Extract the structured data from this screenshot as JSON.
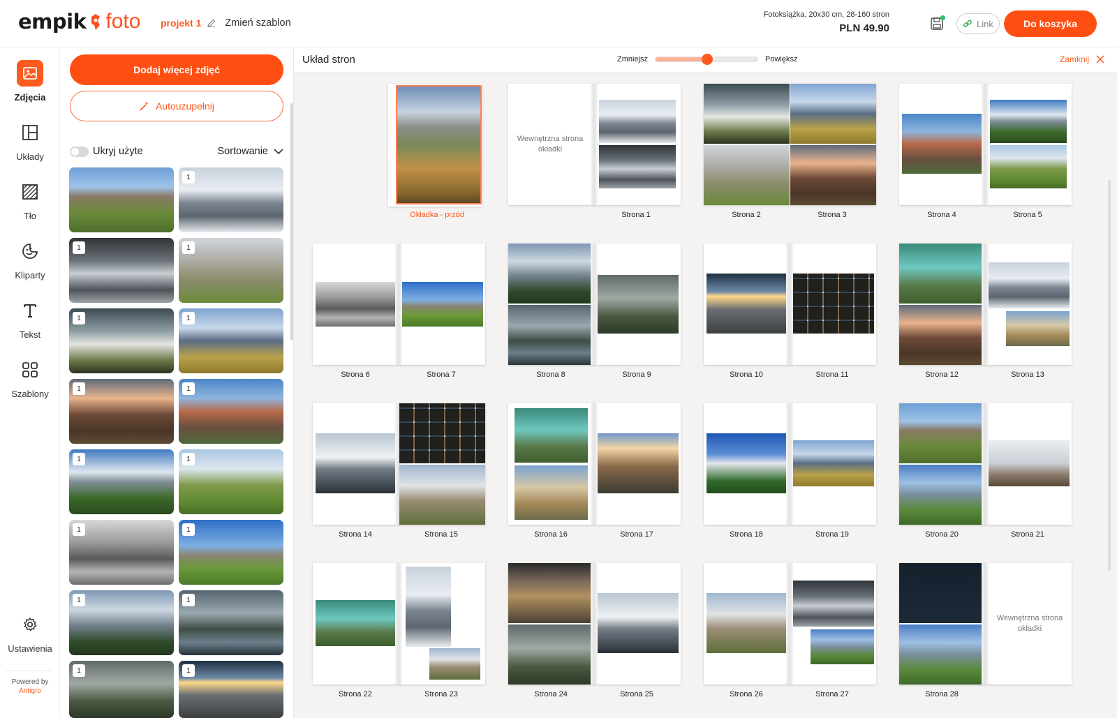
{
  "header": {
    "logo_word": "empik",
    "logo_foto": "foto",
    "project_name": "projekt 1",
    "change_template": "Zmień szablon",
    "product_desc": "Fotoksiążka, 20x30 cm, 28-160 stron",
    "price": "PLN 49.90",
    "link_label": "Link",
    "cart_label": "Do koszyka",
    "accent": "#ff4e12"
  },
  "nav": {
    "items": [
      {
        "label": "Zdjęcia",
        "icon": "image-icon"
      },
      {
        "label": "Układy",
        "icon": "layout-icon"
      },
      {
        "label": "Tło",
        "icon": "background-icon"
      },
      {
        "label": "Kliparty",
        "icon": "clipart-icon"
      },
      {
        "label": "Tekst",
        "icon": "text-icon"
      },
      {
        "label": "Szablony",
        "icon": "templates-icon"
      }
    ],
    "settings_label": "Ustawienia",
    "powered_by": "Powered by",
    "powered_brand": "Antigro"
  },
  "panel": {
    "add_photos": "Dodaj więcej zdjęć",
    "autofill": "Autouzupełnij",
    "hide_used": "Ukryj użyte",
    "hide_used_on": false,
    "sort_label": "Sortowanie",
    "photos": [
      {
        "badge": ""
      },
      {
        "badge": "1"
      },
      {
        "badge": "1"
      },
      {
        "badge": "1"
      },
      {
        "badge": "1"
      },
      {
        "badge": "1"
      },
      {
        "badge": "1"
      },
      {
        "badge": "1"
      },
      {
        "badge": "1"
      },
      {
        "badge": "1"
      },
      {
        "badge": "1"
      },
      {
        "badge": "1"
      },
      {
        "badge": "1"
      },
      {
        "badge": "1"
      },
      {
        "badge": "1"
      },
      {
        "badge": "1"
      }
    ]
  },
  "main": {
    "title": "Układ stron",
    "zoom_out": "Zmniejsz",
    "zoom_in": "Powiększ",
    "zoom_level": 0.5,
    "close_label": "Zamknij",
    "cover_label": "Okładka - przód",
    "inner_cover_text": "Wewnętrzna strona okładki",
    "spreads": [
      {
        "left": "",
        "right": "Strona 1"
      },
      {
        "left": "Strona 2",
        "right": "Strona 3"
      },
      {
        "left": "Strona 4",
        "right": "Strona 5"
      },
      {
        "left": "Strona 6",
        "right": "Strona 7"
      },
      {
        "left": "Strona 8",
        "right": "Strona 9"
      },
      {
        "left": "Strona 10",
        "right": "Strona 11"
      },
      {
        "left": "Strona 12",
        "right": "Strona 13"
      },
      {
        "left": "Strona 14",
        "right": "Strona 15"
      },
      {
        "left": "Strona 16",
        "right": "Strona 17"
      },
      {
        "left": "Strona 18",
        "right": "Strona 19"
      },
      {
        "left": "Strona 20",
        "right": "Strona 21"
      },
      {
        "left": "Strona 22",
        "right": "Strona 23"
      },
      {
        "left": "Strona 24",
        "right": "Strona 25"
      },
      {
        "left": "Strona 26",
        "right": "Strona 27"
      },
      {
        "left": "Strona 28",
        "right": ""
      }
    ]
  }
}
